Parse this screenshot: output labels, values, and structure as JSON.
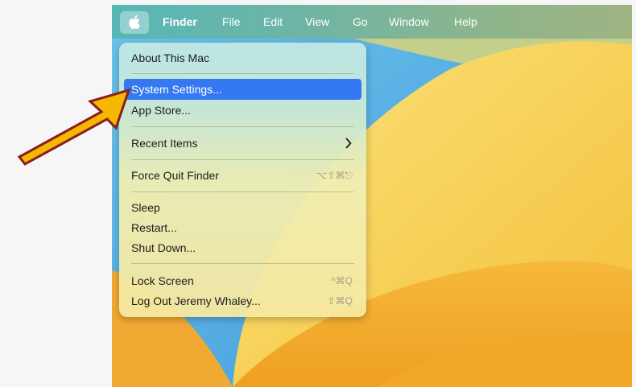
{
  "menubar": {
    "items": [
      "Finder",
      "File",
      "Edit",
      "View",
      "Go",
      "Window",
      "Help"
    ]
  },
  "apple_menu": {
    "items": [
      {
        "label": "About This Mac",
        "shortcut": ""
      },
      {
        "label": "System Settings...",
        "shortcut": "",
        "selected": true
      },
      {
        "label": "App Store...",
        "shortcut": ""
      },
      {
        "label": "Recent Items",
        "shortcut": "",
        "submenu": true
      },
      {
        "label": "Force Quit Finder",
        "shortcut": "⌥⇧⌘⎋"
      },
      {
        "label": "Sleep",
        "shortcut": ""
      },
      {
        "label": "Restart...",
        "shortcut": ""
      },
      {
        "label": "Shut Down...",
        "shortcut": ""
      },
      {
        "label": "Lock Screen",
        "shortcut": "^⌘Q"
      },
      {
        "label": "Log Out Jeremy Whaley...",
        "shortcut": "⇧⌘Q"
      }
    ]
  },
  "icons": {
    "apple": "apple-logo-icon",
    "submenu": "chevron-right-icon",
    "annotation": "arrow-pointer"
  },
  "colors": {
    "highlight": "#3479f2",
    "arrow_fill": "#f5b800",
    "arrow_stroke": "#8b1f1c",
    "wallpaper_blue": "#5fb9e6",
    "wallpaper_yellow": "#f7d046",
    "wallpaper_orange": "#f2a52a"
  }
}
